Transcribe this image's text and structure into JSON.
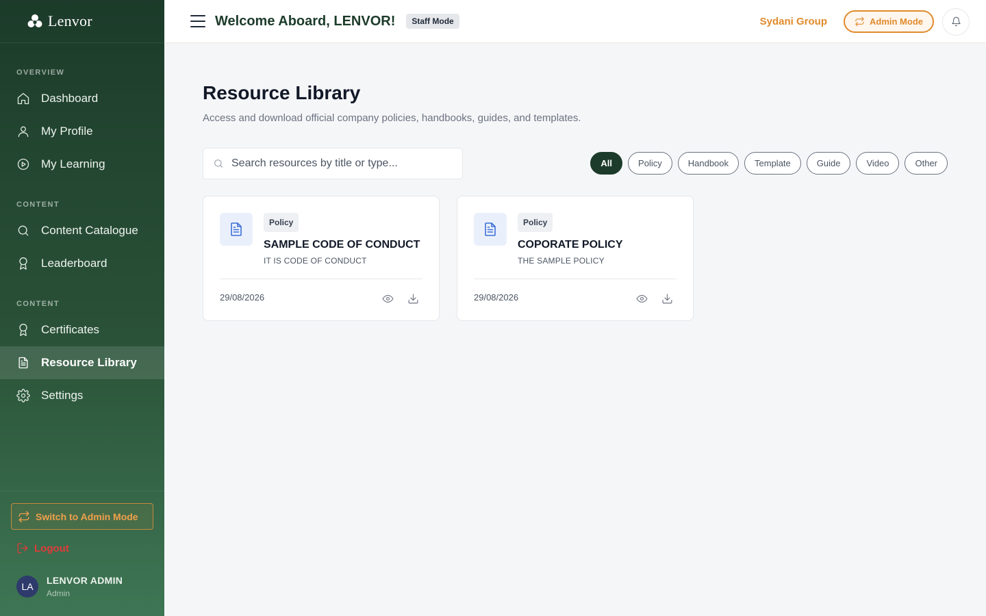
{
  "brand": {
    "name": "Lenvor"
  },
  "sidebar": {
    "sections": [
      {
        "label": "OVERVIEW"
      },
      {
        "label": "CONTENT"
      },
      {
        "label": "CONTENT"
      }
    ],
    "items": [
      {
        "label": "Dashboard",
        "icon": "home-icon"
      },
      {
        "label": "My Profile",
        "icon": "user-icon"
      },
      {
        "label": "My Learning",
        "icon": "play-circle-icon"
      },
      {
        "label": "Content Catalogue",
        "icon": "search-icon"
      },
      {
        "label": "Leaderboard",
        "icon": "award-icon"
      },
      {
        "label": "Certificates",
        "icon": "award-icon"
      },
      {
        "label": "Resource Library",
        "icon": "document-icon",
        "active": true
      },
      {
        "label": "Settings",
        "icon": "gear-icon"
      }
    ],
    "switch_label": "Switch to Admin Mode",
    "logout_label": "Logout",
    "user": {
      "initials": "LA",
      "name": "LENVOR ADMIN",
      "role": "Admin"
    }
  },
  "header": {
    "welcome": "Welcome Aboard, LENVOR!",
    "mode_badge": "Staff Mode",
    "org_name": "Sydani Group",
    "admin_button": "Admin Mode"
  },
  "main": {
    "title": "Resource Library",
    "subtitle": "Access and download official company policies, handbooks, guides, and templates.",
    "search_placeholder": "Search resources by title or type...",
    "filters": [
      {
        "label": "All",
        "active": true
      },
      {
        "label": "Policy"
      },
      {
        "label": "Handbook"
      },
      {
        "label": "Template"
      },
      {
        "label": "Guide"
      },
      {
        "label": "Video"
      },
      {
        "label": "Other"
      }
    ],
    "resources": [
      {
        "tag": "Policy",
        "title": "SAMPLE CODE OF CONDUCT",
        "description": "IT IS CODE OF CONDUCT",
        "date": "29/08/2026"
      },
      {
        "tag": "Policy",
        "title": "COPORATE POLICY",
        "description": "THE SAMPLE POLICY",
        "date": "29/08/2026"
      }
    ]
  },
  "colors": {
    "sidebar_dark": "#1c3b2a",
    "sidebar_light": "#3e7654",
    "accent_orange": "#e08a2c",
    "danger": "#e23b3b",
    "doc_blue": "#3b6fd6"
  }
}
